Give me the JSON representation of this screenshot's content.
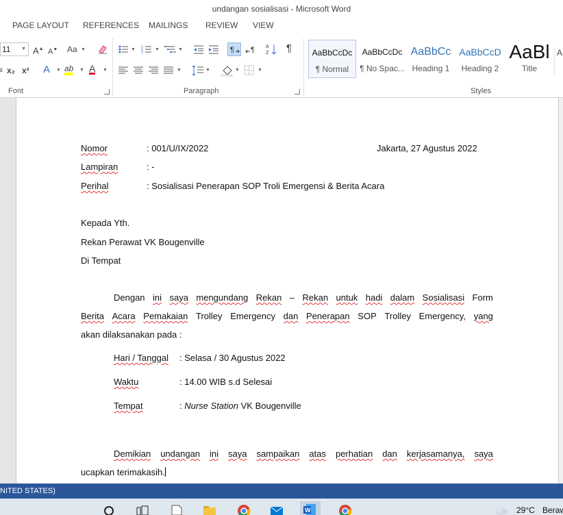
{
  "window": {
    "title": "undangan sosialisasi - Microsoft Word"
  },
  "ribbon_tabs": [
    "PAGE LAYOUT",
    "REFERENCES",
    "MAILINGS",
    "REVIEW",
    "VIEW"
  ],
  "font_group": {
    "font_size": "11",
    "grow_font": "A",
    "shrink_font": "A",
    "change_case": "Aa",
    "subscript": "x₂",
    "superscript": "x²",
    "text_effects": "A",
    "highlight": "ab",
    "font_color": "A",
    "label": "Font",
    "highlight_color": "#ffff00",
    "font_color_value": "#e81123"
  },
  "paragraph_group": {
    "label": "Paragraph",
    "show_marks": "¶"
  },
  "styles_group": {
    "label": "Styles",
    "items": [
      {
        "sample": "AaBbCcDc",
        "name": "¶ Normal"
      },
      {
        "sample": "AaBbCcDc",
        "name": "¶ No Spac..."
      },
      {
        "sample": "AaBbCc",
        "name": "Heading 1"
      },
      {
        "sample": "AaBbCcD",
        "name": "Heading 2"
      },
      {
        "sample": "AaBl",
        "name": "Title"
      }
    ]
  },
  "document": {
    "nomor_label": "Nomor",
    "nomor_value": ": 001/U/IX/2022",
    "place_date": "Jakarta, 27 Agustus 2022",
    "lampiran_label": "Lampiran",
    "lampiran_value": ": -",
    "perihal_label": "Perihal",
    "perihal_value": ": Sosialisasi Penerapan SOP Troli Emergensi & Berita Acara",
    "kepada": "Kepada Yth.",
    "recipient": "Rekan Perawat VK Bougenville",
    "di_tempat": "Di Tempat",
    "para1_line1": [
      "Dengan",
      "ini",
      "saya",
      "mengundang",
      "Rekan",
      "–",
      "Rekan",
      "untuk",
      "hadi",
      "dalam",
      "Sosialisasi",
      "Form"
    ],
    "para1_line2": [
      "Berita",
      "Acara",
      "Pemakaian",
      "Trolley",
      "Emergency",
      "dan",
      "Penerapan",
      "SOP",
      "Trolley",
      "Emergency,",
      "yang"
    ],
    "para1_line3": "akan dilaksanakan pada :",
    "hari_label": "Hari / Tanggal",
    "hari_value": ": Selasa / 30 Agustus 2022",
    "waktu_label": "Waktu",
    "waktu_value": ": 14.00 WIB s.d Selesai",
    "tempat_label": "Tempat",
    "tempat_prefix": ": ",
    "tempat_italic": "Nurse Station",
    "tempat_rest": " VK Bougenville",
    "closing_line1": [
      "Demikian",
      "undangan",
      "ini",
      "saya",
      "sampaikan",
      "atas",
      "perhatian",
      "dan",
      "kerjasamanya,",
      "saya"
    ],
    "closing_line2": "ucapkan terimakasih."
  },
  "status_bar": {
    "language": "NITED STATES)"
  },
  "taskbar": {
    "weather": "29°C",
    "weather_extra": "Beraw"
  }
}
